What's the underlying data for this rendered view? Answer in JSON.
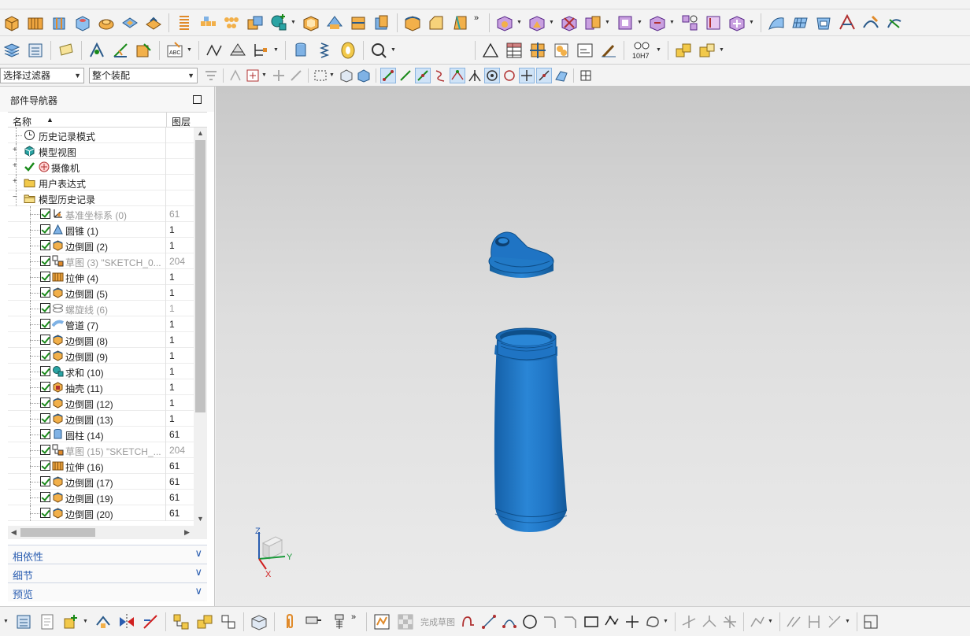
{
  "colors": {
    "accent": "#2a5db0",
    "model_blue": "#1f74c4",
    "checkbox_green": "#1a8a1a"
  },
  "filters": {
    "selection_filter": "选择过滤器",
    "scope": "整个装配"
  },
  "navigator": {
    "title": "部件导航器",
    "col_name": "名称",
    "col_layer": "图层",
    "nodes": [
      {
        "label": "历史记录模式",
        "layer": ""
      },
      {
        "label": "模型视图",
        "layer": ""
      },
      {
        "label": "摄像机",
        "layer": ""
      },
      {
        "label": "用户表达式",
        "layer": ""
      },
      {
        "label": "模型历史记录",
        "layer": ""
      }
    ],
    "features": [
      {
        "label": "基准坐标系 (0)",
        "layer": "61",
        "icon": "datum-csys-icon",
        "dim": true
      },
      {
        "label": "圆锥 (1)",
        "layer": "1",
        "icon": "cone-icon",
        "dim": false
      },
      {
        "label": "边倒圆 (2)",
        "layer": "1",
        "icon": "edge-blend-icon",
        "dim": false
      },
      {
        "label": "草图 (3) \"SKETCH_0...",
        "layer": "204",
        "icon": "sketch-icon",
        "dim": true
      },
      {
        "label": "拉伸 (4)",
        "layer": "1",
        "icon": "extrude-icon",
        "dim": false
      },
      {
        "label": "边倒圆 (5)",
        "layer": "1",
        "icon": "edge-blend-icon",
        "dim": false
      },
      {
        "label": "螺旋线 (6)",
        "layer": "1",
        "icon": "helix-icon",
        "dim": true
      },
      {
        "label": "管道 (7)",
        "layer": "1",
        "icon": "tube-icon",
        "dim": false
      },
      {
        "label": "边倒圆 (8)",
        "layer": "1",
        "icon": "edge-blend-icon",
        "dim": false
      },
      {
        "label": "边倒圆 (9)",
        "layer": "1",
        "icon": "edge-blend-icon",
        "dim": false
      },
      {
        "label": "求和 (10)",
        "layer": "1",
        "icon": "unite-icon",
        "dim": false
      },
      {
        "label": "抽壳 (11)",
        "layer": "1",
        "icon": "shell-icon",
        "dim": false
      },
      {
        "label": "边倒圆 (12)",
        "layer": "1",
        "icon": "edge-blend-icon",
        "dim": false
      },
      {
        "label": "边倒圆 (13)",
        "layer": "1",
        "icon": "edge-blend-icon",
        "dim": false
      },
      {
        "label": "圆柱 (14)",
        "layer": "61",
        "icon": "cylinder-icon",
        "dim": false
      },
      {
        "label": "草图 (15) \"SKETCH_...",
        "layer": "204",
        "icon": "sketch-icon",
        "dim": true
      },
      {
        "label": "拉伸 (16)",
        "layer": "61",
        "icon": "extrude-icon",
        "dim": false
      },
      {
        "label": "边倒圆 (17)",
        "layer": "61",
        "icon": "edge-blend-icon",
        "dim": false
      },
      {
        "label": "边倒圆 (19)",
        "layer": "61",
        "icon": "edge-blend-icon",
        "dim": false
      },
      {
        "label": "边倒圆 (20)",
        "layer": "61",
        "icon": "edge-blend-icon",
        "dim": false
      }
    ],
    "panels": {
      "dependencies": "相依性",
      "details": "细节",
      "preview": "预览"
    }
  },
  "toolbar": {
    "tolerance_label": "10H7",
    "finish_sketch_label": "完成草图"
  },
  "triad": {
    "x": "X",
    "y": "Y",
    "z": "Z"
  }
}
